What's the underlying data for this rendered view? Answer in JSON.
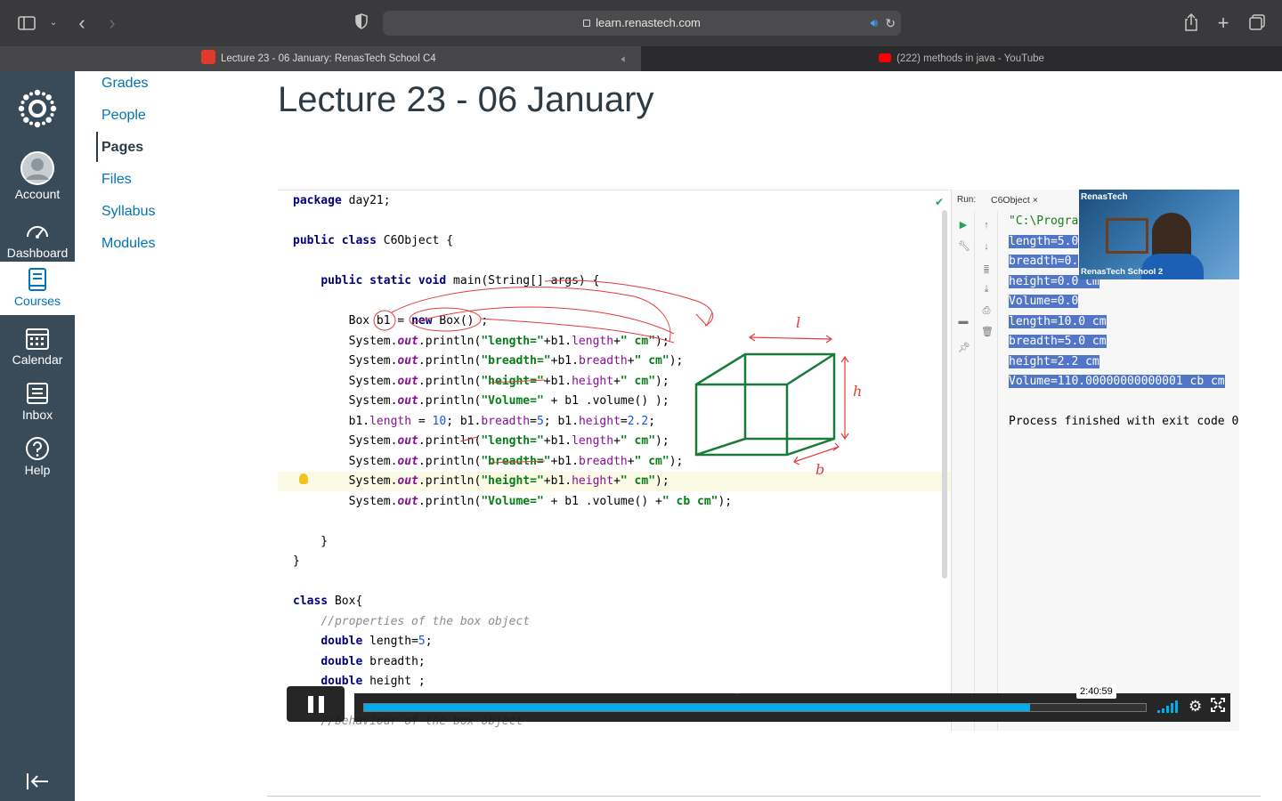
{
  "browser": {
    "url": "learn.renastech.com",
    "tabs": [
      {
        "title": "Lecture 23 - 06 January: RenasTech School C4",
        "favicon": "canvas-icon",
        "active": true
      },
      {
        "title": "(222) methods in java - YouTube",
        "favicon": "youtube-icon",
        "active": false
      }
    ]
  },
  "global_nav": {
    "items": [
      {
        "label": "Account",
        "icon": "account-icon"
      },
      {
        "label": "Dashboard",
        "icon": "dashboard-icon"
      },
      {
        "label": "Courses",
        "icon": "courses-icon",
        "active": true
      },
      {
        "label": "Calendar",
        "icon": "calendar-icon"
      },
      {
        "label": "Inbox",
        "icon": "inbox-icon"
      },
      {
        "label": "Help",
        "icon": "help-icon"
      }
    ]
  },
  "course_nav": {
    "items": [
      "Grades",
      "People",
      "Pages",
      "Files",
      "Syllabus",
      "Modules"
    ],
    "active": "Pages"
  },
  "page": {
    "title": "Lecture 23 - 06 January"
  },
  "video": {
    "editor_lines": [
      "package day21;",
      "",
      "public class C6Object {",
      "",
      "    public static void main(String[] args) {",
      "",
      "        Box b1 = new Box() ;",
      "        System.out.println(\"length=\"+b1.length+\" cm\");",
      "        System.out.println(\"breadth=\"+b1.breadth+\" cm\");",
      "        System.out.println(\"height=\"+b1.height+\" cm\");",
      "        System.out.println(\"Volume=\" + b1 .volume() );",
      "        b1.length = 10; b1.breadth=5; b1.height=2.2;",
      "        System.out.println(\"length=\"+b1.length+\" cm\");",
      "        System.out.println(\"breadth=\"+b1.breadth+\" cm\");",
      "        System.out.println(\"height=\"+b1.height+\" cm\");",
      "        System.out.println(\"Volume=\" + b1 .volume() +\" cb cm\");",
      "",
      "    }",
      "}",
      "",
      "class Box{",
      "    //properties of the box object",
      "    double length=5;",
      "    double breadth;",
      "    double height ;",
      "",
      "    //behaviour of the box object"
    ],
    "run_label": "Run:",
    "run_tab": "C6Object",
    "console_lines": [
      "\"C:\\Progra",
      "length=5.0",
      "breadth=0.",
      "height=0.0 cm",
      "Volume=0.0",
      "length=10.0 cm",
      "breadth=5.0 cm",
      "height=2.2 cm",
      "Volume=110.00000000000001 cb cm",
      "",
      "Process finished with exit code 0"
    ],
    "webcam": {
      "brand": "RenasTech",
      "caption": "RenasTech School 2"
    },
    "annotations": {
      "length_mark": "l",
      "height_mark": "h",
      "breadth_mark": "b"
    },
    "player": {
      "time_tooltip": "2:40:59",
      "progress": 0.852,
      "accent": "#00adef"
    }
  },
  "colors": {
    "global_nav_bg": "#394b58",
    "link": "#0374b5",
    "console_selection": "#5276c7"
  }
}
